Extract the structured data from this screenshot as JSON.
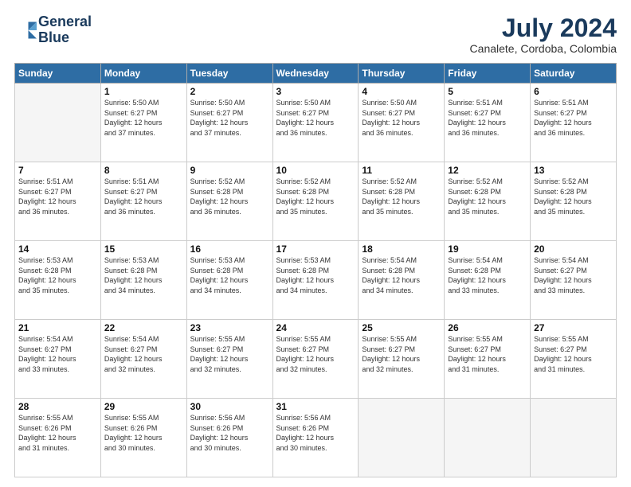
{
  "header": {
    "logo_line1": "General",
    "logo_line2": "Blue",
    "month_year": "July 2024",
    "location": "Canalete, Cordoba, Colombia"
  },
  "weekdays": [
    "Sunday",
    "Monday",
    "Tuesday",
    "Wednesday",
    "Thursday",
    "Friday",
    "Saturday"
  ],
  "weeks": [
    [
      {
        "day": "",
        "info": ""
      },
      {
        "day": "1",
        "info": "Sunrise: 5:50 AM\nSunset: 6:27 PM\nDaylight: 12 hours\nand 37 minutes."
      },
      {
        "day": "2",
        "info": "Sunrise: 5:50 AM\nSunset: 6:27 PM\nDaylight: 12 hours\nand 37 minutes."
      },
      {
        "day": "3",
        "info": "Sunrise: 5:50 AM\nSunset: 6:27 PM\nDaylight: 12 hours\nand 36 minutes."
      },
      {
        "day": "4",
        "info": "Sunrise: 5:50 AM\nSunset: 6:27 PM\nDaylight: 12 hours\nand 36 minutes."
      },
      {
        "day": "5",
        "info": "Sunrise: 5:51 AM\nSunset: 6:27 PM\nDaylight: 12 hours\nand 36 minutes."
      },
      {
        "day": "6",
        "info": "Sunrise: 5:51 AM\nSunset: 6:27 PM\nDaylight: 12 hours\nand 36 minutes."
      }
    ],
    [
      {
        "day": "7",
        "info": "Sunrise: 5:51 AM\nSunset: 6:27 PM\nDaylight: 12 hours\nand 36 minutes."
      },
      {
        "day": "8",
        "info": "Sunrise: 5:51 AM\nSunset: 6:27 PM\nDaylight: 12 hours\nand 36 minutes."
      },
      {
        "day": "9",
        "info": "Sunrise: 5:52 AM\nSunset: 6:28 PM\nDaylight: 12 hours\nand 36 minutes."
      },
      {
        "day": "10",
        "info": "Sunrise: 5:52 AM\nSunset: 6:28 PM\nDaylight: 12 hours\nand 35 minutes."
      },
      {
        "day": "11",
        "info": "Sunrise: 5:52 AM\nSunset: 6:28 PM\nDaylight: 12 hours\nand 35 minutes."
      },
      {
        "day": "12",
        "info": "Sunrise: 5:52 AM\nSunset: 6:28 PM\nDaylight: 12 hours\nand 35 minutes."
      },
      {
        "day": "13",
        "info": "Sunrise: 5:52 AM\nSunset: 6:28 PM\nDaylight: 12 hours\nand 35 minutes."
      }
    ],
    [
      {
        "day": "14",
        "info": "Sunrise: 5:53 AM\nSunset: 6:28 PM\nDaylight: 12 hours\nand 35 minutes."
      },
      {
        "day": "15",
        "info": "Sunrise: 5:53 AM\nSunset: 6:28 PM\nDaylight: 12 hours\nand 34 minutes."
      },
      {
        "day": "16",
        "info": "Sunrise: 5:53 AM\nSunset: 6:28 PM\nDaylight: 12 hours\nand 34 minutes."
      },
      {
        "day": "17",
        "info": "Sunrise: 5:53 AM\nSunset: 6:28 PM\nDaylight: 12 hours\nand 34 minutes."
      },
      {
        "day": "18",
        "info": "Sunrise: 5:54 AM\nSunset: 6:28 PM\nDaylight: 12 hours\nand 34 minutes."
      },
      {
        "day": "19",
        "info": "Sunrise: 5:54 AM\nSunset: 6:28 PM\nDaylight: 12 hours\nand 33 minutes."
      },
      {
        "day": "20",
        "info": "Sunrise: 5:54 AM\nSunset: 6:27 PM\nDaylight: 12 hours\nand 33 minutes."
      }
    ],
    [
      {
        "day": "21",
        "info": "Sunrise: 5:54 AM\nSunset: 6:27 PM\nDaylight: 12 hours\nand 33 minutes."
      },
      {
        "day": "22",
        "info": "Sunrise: 5:54 AM\nSunset: 6:27 PM\nDaylight: 12 hours\nand 32 minutes."
      },
      {
        "day": "23",
        "info": "Sunrise: 5:55 AM\nSunset: 6:27 PM\nDaylight: 12 hours\nand 32 minutes."
      },
      {
        "day": "24",
        "info": "Sunrise: 5:55 AM\nSunset: 6:27 PM\nDaylight: 12 hours\nand 32 minutes."
      },
      {
        "day": "25",
        "info": "Sunrise: 5:55 AM\nSunset: 6:27 PM\nDaylight: 12 hours\nand 32 minutes."
      },
      {
        "day": "26",
        "info": "Sunrise: 5:55 AM\nSunset: 6:27 PM\nDaylight: 12 hours\nand 31 minutes."
      },
      {
        "day": "27",
        "info": "Sunrise: 5:55 AM\nSunset: 6:27 PM\nDaylight: 12 hours\nand 31 minutes."
      }
    ],
    [
      {
        "day": "28",
        "info": "Sunrise: 5:55 AM\nSunset: 6:26 PM\nDaylight: 12 hours\nand 31 minutes."
      },
      {
        "day": "29",
        "info": "Sunrise: 5:55 AM\nSunset: 6:26 PM\nDaylight: 12 hours\nand 30 minutes."
      },
      {
        "day": "30",
        "info": "Sunrise: 5:56 AM\nSunset: 6:26 PM\nDaylight: 12 hours\nand 30 minutes."
      },
      {
        "day": "31",
        "info": "Sunrise: 5:56 AM\nSunset: 6:26 PM\nDaylight: 12 hours\nand 30 minutes."
      },
      {
        "day": "",
        "info": ""
      },
      {
        "day": "",
        "info": ""
      },
      {
        "day": "",
        "info": ""
      }
    ]
  ]
}
